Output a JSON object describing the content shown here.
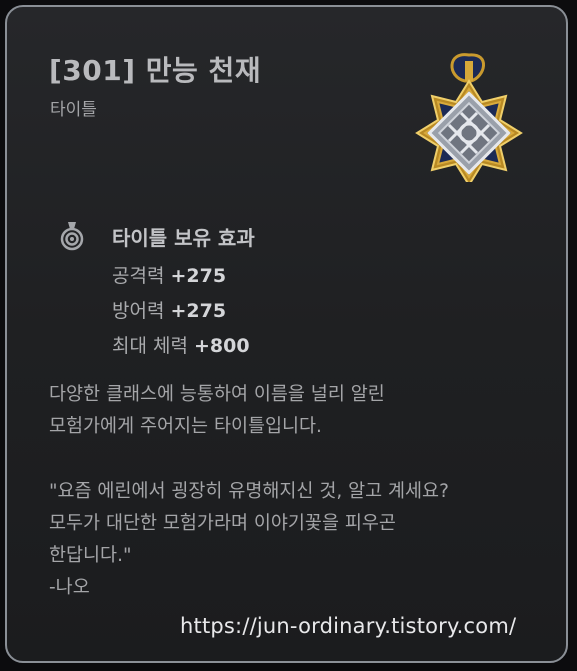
{
  "item": {
    "title": "[301] 만능 천재",
    "category": "타이틀",
    "icon": "title-medal-icon"
  },
  "effect": {
    "icon": "medal-icon",
    "header": "타이틀 보유 효과",
    "stats": [
      {
        "label": "공격력",
        "value": "+275"
      },
      {
        "label": "방어력",
        "value": "+275"
      },
      {
        "label": "최대 체력",
        "value": "+800"
      }
    ]
  },
  "description": [
    "다양한 클래스에 능통하여 이름을 널리 알린",
    "모험가에게 주어지는 타이틀입니다."
  ],
  "quote": {
    "lines": [
      "\"요즘 에린에서 굉장히 유명해지신 것, 알고 계세요?",
      "모두가 대단한 모험가라며 이야기꽃을 피우곤",
      "한답니다.\""
    ],
    "author": "-나오"
  },
  "watermark": "https://jun-ordinary.tistory.com/",
  "colors": {
    "border": "#8a8f96",
    "background": "#222325",
    "icon_gold": "#c99a2e",
    "icon_navy": "#1c2a55"
  }
}
